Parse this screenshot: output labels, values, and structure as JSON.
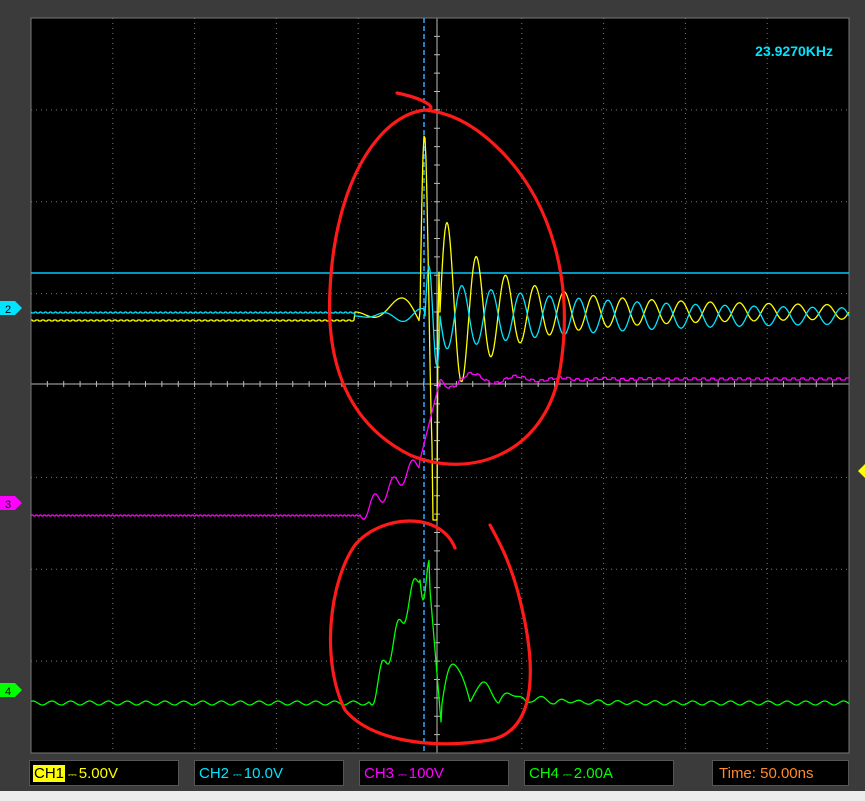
{
  "frequency_readout": "23.9270KHz",
  "time_base": "Time: 50.00ns",
  "channels": [
    {
      "id": "ch1",
      "label": "CH1",
      "coupling": "⎓",
      "scale": "5.00V",
      "color": "#ffff00",
      "marker": "1"
    },
    {
      "id": "ch2",
      "label": "CH2",
      "coupling": "⎓",
      "scale": "10.0V",
      "color": "#00e5ff",
      "marker": "2"
    },
    {
      "id": "ch3",
      "label": "CH3",
      "coupling": "⎓",
      "scale": "100V",
      "color": "#ff00ff",
      "marker": "3"
    },
    {
      "id": "ch4",
      "label": "CH4",
      "coupling": "⎓",
      "scale": "2.00A",
      "color": "#00ff00",
      "marker": "4"
    }
  ],
  "colors": {
    "background": "#000000",
    "grid": "#7a7a7a",
    "cursor": "#00c8ff",
    "annotation": "#ff1a1a",
    "time_text": "#ff8a2a"
  }
}
